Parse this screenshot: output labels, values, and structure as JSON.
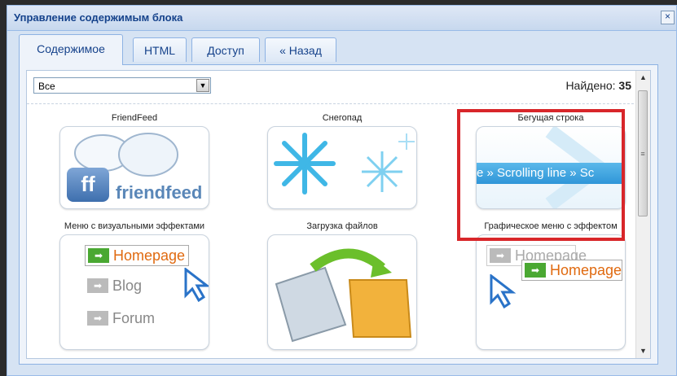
{
  "dialog": {
    "title": "Управление содержимым блока",
    "close_label": "×"
  },
  "tabs": [
    {
      "label": "Содержимое",
      "active": true
    },
    {
      "label": "HTML",
      "active": false
    },
    {
      "label": "Доступ",
      "active": false
    },
    {
      "label": "« Назад",
      "active": false
    }
  ],
  "filter": {
    "selected": "Все"
  },
  "found": {
    "label": "Найдено:",
    "count": "35"
  },
  "items": [
    {
      "title": "FriendFeed",
      "thumb_text": "friendfeed",
      "thumb_logo": "ff"
    },
    {
      "title": "Снегопад"
    },
    {
      "title": "Бегущая строка",
      "thumb_text": "e » Scrolling line » Sc"
    },
    {
      "title": "Меню с визуальными эффектами",
      "menu": [
        "Homepage",
        "Blog",
        "Forum"
      ]
    },
    {
      "title": "Загрузка файлов"
    },
    {
      "title": "Графическое меню с эффектом",
      "menu": [
        "Homepage",
        "Homepage"
      ]
    }
  ],
  "colors": {
    "highlight": "#d8262a",
    "tab_text": "#15428b"
  }
}
